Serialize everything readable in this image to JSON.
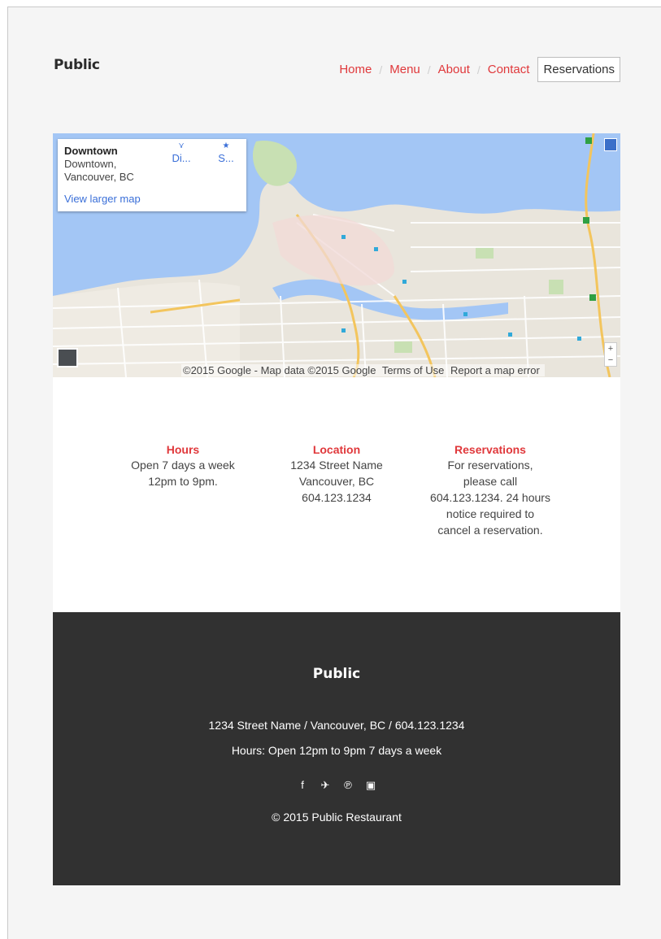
{
  "header": {
    "logo": "Public",
    "nav": [
      {
        "label": "Home"
      },
      {
        "label": "Menu"
      },
      {
        "label": "About"
      },
      {
        "label": "Contact"
      }
    ],
    "separator": "/",
    "reservations_button": "Reservations"
  },
  "map": {
    "place_name": "Downtown",
    "address": "Downtown, Vancouver, BC",
    "view_larger": "View larger map",
    "directions_label": "Di...",
    "save_label": "S...",
    "directions_icon": "directions-icon",
    "save_icon": "star-icon",
    "attribution": "©2015 Google - Map data ©2015 Google",
    "terms": "Terms of Use",
    "report": "Report a map error",
    "zoom_in": "+",
    "zoom_out": "−",
    "colors": {
      "water": "#a3c6f5",
      "land": "#e9e5dc",
      "park": "#c8e0b3",
      "road": "#f3c55d"
    }
  },
  "info": {
    "hours": {
      "title": "Hours",
      "lines": [
        "Open 7 days a week",
        "12pm to 9pm."
      ]
    },
    "location": {
      "title": "Location",
      "lines": [
        "1234 Street Name",
        "Vancouver, BC",
        "604.123.1234"
      ]
    },
    "reservations": {
      "title": "Reservations",
      "lines": [
        "For reservations,",
        "please call",
        "604.123.1234. 24 hours",
        "notice required to",
        "cancel a reservation."
      ]
    }
  },
  "footer": {
    "logo": "Public",
    "address": "1234 Street Name / Vancouver, BC / 604.123.1234",
    "hours": "Hours: Open 12pm to 9pm 7 days a week",
    "social": [
      {
        "icon": "facebook-icon",
        "glyph": "f"
      },
      {
        "icon": "twitter-icon",
        "glyph": "✈"
      },
      {
        "icon": "pinterest-icon",
        "glyph": "℗"
      },
      {
        "icon": "instagram-icon",
        "glyph": "▣"
      }
    ],
    "copyright": "© 2015 Public Restaurant"
  },
  "accent_color": "#e0383b",
  "footer_bg": "#313131"
}
